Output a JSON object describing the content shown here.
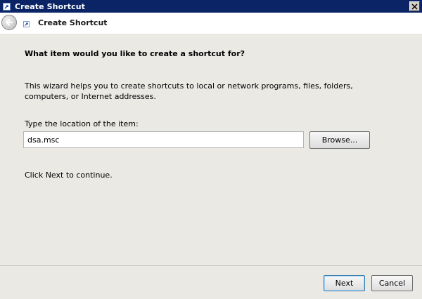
{
  "window": {
    "title": "Create Shortcut",
    "close_label": "✕"
  },
  "header": {
    "title": "Create Shortcut"
  },
  "content": {
    "heading": "What item would you like to create a shortcut for?",
    "description": "This wizard helps you to create shortcuts to local or network programs, files, folders, computers, or Internet addresses.",
    "location_label": "Type the location of the item:",
    "location_value": "dsa.msc",
    "browse_label": "Browse...",
    "continue_text": "Click Next to continue."
  },
  "footer": {
    "next_label": "Next",
    "cancel_label": "Cancel"
  },
  "colors": {
    "titlebar": "#0a2466",
    "panel": "#ebe9e4",
    "default_button_border": "#3c7fb1"
  }
}
